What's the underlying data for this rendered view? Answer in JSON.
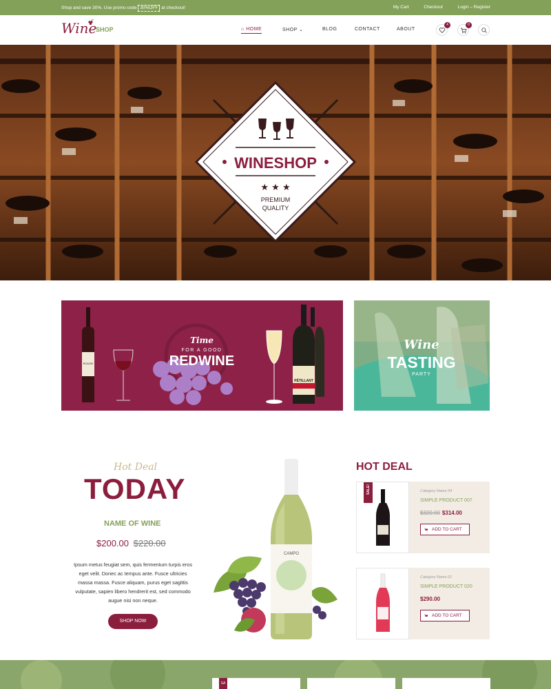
{
  "topbar": {
    "promo_prefix": "Shop and save 30%. Use promo code",
    "promo_code": "30%OFF",
    "promo_suffix": "at checkout!",
    "my_cart": "My Cart",
    "checkout": "Checkout",
    "login": "Login – Register"
  },
  "header": {
    "logo_script": "Wine",
    "logo_shop": "SHOP",
    "nav": [
      {
        "label": "HOME"
      },
      {
        "label": "SHOP"
      },
      {
        "label": "BLOG"
      },
      {
        "label": "CONTACT"
      },
      {
        "label": "ABOUT"
      }
    ],
    "wishlist_count": "4",
    "cart_count": "0"
  },
  "hero": {
    "brand": "WINESHOP",
    "tag1": "PREMIUM",
    "tag2": "QUALITY"
  },
  "banner1": {
    "script": "Time",
    "sub": "FOR A GOOD",
    "main": "REDWINE",
    "bottle_label": "ROUGE",
    "bottle2_label": "PÉTILLANT"
  },
  "banner2": {
    "script": "Wine",
    "main": "TASTING",
    "sub": "PARTY"
  },
  "deal": {
    "script": "Hot Deal",
    "title": "TODAY",
    "name": "NAME OF WINE",
    "price": "$200.00",
    "old_price": "$220.00",
    "description": "Ipsum metus feugiat sem, quis fermentum turpis eros eget velit. Donec ac tempus ante. Fusce ultricies massa massa. Fusce aliquam, purus eget sagittis vulputate, sapien libero hendrerit est, sed commodo augue nisi non neque.",
    "button": "SHOP NOW",
    "bottle_label": "CAMPO"
  },
  "hotdeal": {
    "title": "HOT DEAL",
    "products": [
      {
        "category": "Category Name 04",
        "name": "SIMPLE PRODUCT 007",
        "old_price": "$320.00",
        "price": "$314.00",
        "button": "ADD TO CART",
        "sale": "SALE!"
      },
      {
        "category": "Category Name 01",
        "name": "SIMPLE PRODUCT 020",
        "old_price": "",
        "price": "$290.00",
        "button": "ADD TO CART"
      }
    ]
  },
  "bottom": {
    "sale": "SA"
  },
  "colors": {
    "brand": "#8b1d3d",
    "accent": "#84a159",
    "cream": "#f3ece4"
  }
}
